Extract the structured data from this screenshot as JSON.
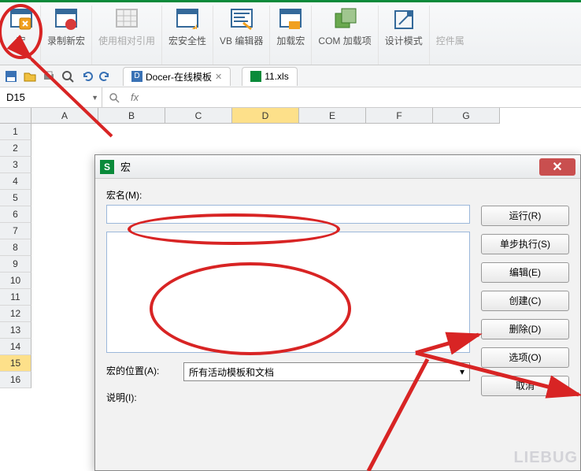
{
  "ribbon": {
    "macro": "宏",
    "record": "录制新宏",
    "relref": "使用相对引用",
    "security": "宏安全性",
    "vbe": "VB 编辑器",
    "addin": "加载宏",
    "comaddin": "COM 加载项",
    "design": "设计模式",
    "controls": "控件属"
  },
  "tabs": {
    "docer": "Docer-在线模板",
    "file": "11.xls"
  },
  "namebox": "D15",
  "fx": "fx",
  "cols": [
    "A",
    "B",
    "C",
    "D",
    "E",
    "F",
    "G"
  ],
  "rows": [
    "1",
    "2",
    "3",
    "4",
    "5",
    "6",
    "7",
    "8",
    "9",
    "10",
    "11",
    "12",
    "13",
    "14",
    "15",
    "16"
  ],
  "dialog": {
    "title": "宏",
    "name_label": "宏名(M):",
    "loc_label": "宏的位置(A):",
    "loc_value": "所有活动模板和文档",
    "desc_label": "说明(I):",
    "btn_run": "运行(R)",
    "btn_step": "单步执行(S)",
    "btn_edit": "编辑(E)",
    "btn_create": "创建(C)",
    "btn_delete": "删除(D)",
    "btn_options": "选项(O)",
    "btn_cancel": "取消"
  },
  "watermark": "LIEBUG"
}
